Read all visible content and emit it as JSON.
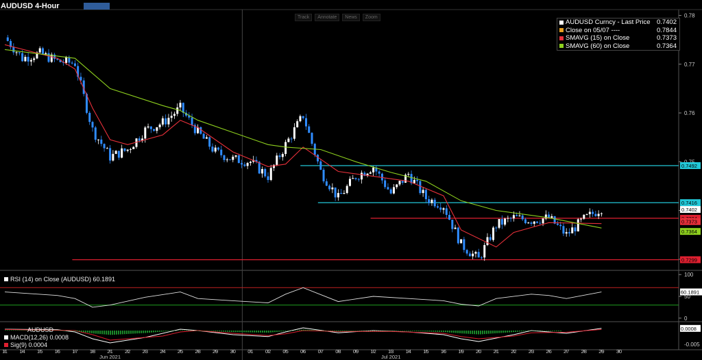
{
  "header": {
    "title": "AUDUSD 4-Hour",
    "toolbar": [
      "Track",
      "Annotate",
      "News",
      "Zoom"
    ]
  },
  "legend": [
    {
      "name": "AUDUSD Curncy - Last Price",
      "value": "0.7402",
      "color": "#ffffff"
    },
    {
      "name": "Close on 05/07 ----",
      "value": "0.7844",
      "color": "#e8a020"
    },
    {
      "name": "SMAVG (15)  on Close",
      "value": "0.7373",
      "color": "#e8303a"
    },
    {
      "name": "SMAVG (60)  on Close",
      "value": "0.7364",
      "color": "#8ed01e"
    }
  ],
  "rsi_panel": {
    "label": "RSI (14)  on Close (AUDUSD) 60.1891"
  },
  "macd_panel": {
    "ticker": "AUDUSD",
    "macd_label": "MACD(12,26) 0.0008",
    "sig_label": "Sig(9) 0.0004"
  },
  "chart_data": [
    {
      "type": "candlestick",
      "title": "AUDUSD 4-Hour",
      "y_ticks": [
        0.73,
        0.74,
        0.75,
        0.76,
        0.77,
        0.78
      ],
      "ylim": [
        0.728,
        0.7812
      ],
      "x_tick_labels": [
        "11",
        "14",
        "15",
        "16",
        "17",
        "18",
        "21",
        "22",
        "23",
        "24",
        "25",
        "28",
        "29",
        "30",
        "01",
        "02",
        "05",
        "06",
        "07",
        "08",
        "09",
        "12",
        "13",
        "14",
        "15",
        "16",
        "19",
        "20",
        "21",
        "22",
        "23",
        "26",
        "27",
        "28",
        "29",
        "30"
      ],
      "month_labels": [
        {
          "label": "Jun 2021",
          "at": "21"
        },
        {
          "label": "Jul 2021",
          "at": "13"
        }
      ],
      "horizontal_lines": [
        {
          "value": 0.7492,
          "label": "0.7492",
          "color": "#22c8d8",
          "start_date": "06",
          "extends_to_right": true
        },
        {
          "value": 0.7416,
          "label": "0.7416",
          "color": "#22c8d8",
          "start_date": "07",
          "extends_to_right": true
        },
        {
          "value": 0.7384,
          "label": "0.7384",
          "color": "#e02030",
          "start_date": "12",
          "extends_to_right": true
        },
        {
          "value": 0.7299,
          "label": "0.7299",
          "color": "#e02030",
          "start_date": "17",
          "extends_to_right": true
        }
      ],
      "value_tags": [
        {
          "value": 0.7402,
          "label": "0.7402",
          "color": "#ffffff"
        },
        {
          "value": 0.7373,
          "label": "0.7373",
          "color": "#e8303a"
        },
        {
          "value": 0.7364,
          "label": "0.7364",
          "color": "#8ed01e"
        }
      ],
      "price_path": [
        {
          "x": "11",
          "y": 0.7755
        },
        {
          "x": "14",
          "y": 0.7712
        },
        {
          "x": "15",
          "y": 0.7722
        },
        {
          "x": "16",
          "y": 0.7706
        },
        {
          "x": "17",
          "y": 0.7702
        },
        {
          "x": "18",
          "y": 0.7565
        },
        {
          "x": "21",
          "y": 0.751
        },
        {
          "x": "22",
          "y": 0.7525
        },
        {
          "x": "23",
          "y": 0.7565
        },
        {
          "x": "24",
          "y": 0.758
        },
        {
          "x": "25",
          "y": 0.761
        },
        {
          "x": "28",
          "y": 0.756
        },
        {
          "x": "29",
          "y": 0.752
        },
        {
          "x": "30",
          "y": 0.7505
        },
        {
          "x": "01",
          "y": 0.75
        },
        {
          "x": "02",
          "y": 0.747
        },
        {
          "x": "05",
          "y": 0.7535
        },
        {
          "x": "06",
          "y": 0.7595
        },
        {
          "x": "07",
          "y": 0.748
        },
        {
          "x": "08",
          "y": 0.7425
        },
        {
          "x": "09",
          "y": 0.747
        },
        {
          "x": "12",
          "y": 0.749
        },
        {
          "x": "13",
          "y": 0.7435
        },
        {
          "x": "14",
          "y": 0.7475
        },
        {
          "x": "15",
          "y": 0.7425
        },
        {
          "x": "16",
          "y": 0.741
        },
        {
          "x": "19",
          "y": 0.733
        },
        {
          "x": "20",
          "y": 0.73
        },
        {
          "x": "21",
          "y": 0.737
        },
        {
          "x": "22",
          "y": 0.7385
        },
        {
          "x": "23",
          "y": 0.738
        },
        {
          "x": "26",
          "y": 0.7385
        },
        {
          "x": "27",
          "y": 0.735
        },
        {
          "x": "28",
          "y": 0.7382
        },
        {
          "x": "29",
          "y": 0.7405
        }
      ],
      "series": [
        {
          "name": "SMAVG (15)  on Close",
          "color": "#e8303a",
          "values": [
            {
              "x": "11",
              "y": 0.774
            },
            {
              "x": "16",
              "y": 0.7712
            },
            {
              "x": "17",
              "y": 0.769
            },
            {
              "x": "18",
              "y": 0.761
            },
            {
              "x": "21",
              "y": 0.7545
            },
            {
              "x": "22",
              "y": 0.7535
            },
            {
              "x": "24",
              "y": 0.7555
            },
            {
              "x": "25",
              "y": 0.7585
            },
            {
              "x": "28",
              "y": 0.757
            },
            {
              "x": "30",
              "y": 0.752
            },
            {
              "x": "02",
              "y": 0.749
            },
            {
              "x": "05",
              "y": 0.7495
            },
            {
              "x": "06",
              "y": 0.753
            },
            {
              "x": "08",
              "y": 0.748
            },
            {
              "x": "12",
              "y": 0.747
            },
            {
              "x": "14",
              "y": 0.746
            },
            {
              "x": "16",
              "y": 0.743
            },
            {
              "x": "19",
              "y": 0.736
            },
            {
              "x": "21",
              "y": 0.7325
            },
            {
              "x": "22",
              "y": 0.7355
            },
            {
              "x": "26",
              "y": 0.7375
            },
            {
              "x": "29",
              "y": 0.7373
            }
          ]
        },
        {
          "name": "SMAVG (60)  on Close",
          "color": "#8ed01e",
          "values": [
            {
              "x": "11",
              "y": 0.773
            },
            {
              "x": "17",
              "y": 0.7712
            },
            {
              "x": "21",
              "y": 0.765
            },
            {
              "x": "24",
              "y": 0.7615
            },
            {
              "x": "25",
              "y": 0.7605
            },
            {
              "x": "28",
              "y": 0.7585
            },
            {
              "x": "30",
              "y": 0.756
            },
            {
              "x": "02",
              "y": 0.7535
            },
            {
              "x": "05",
              "y": 0.753
            },
            {
              "x": "07",
              "y": 0.7525
            },
            {
              "x": "09",
              "y": 0.75
            },
            {
              "x": "13",
              "y": 0.7478
            },
            {
              "x": "15",
              "y": 0.746
            },
            {
              "x": "19",
              "y": 0.742
            },
            {
              "x": "21",
              "y": 0.74
            },
            {
              "x": "26",
              "y": 0.7385
            },
            {
              "x": "29",
              "y": 0.7364
            }
          ]
        }
      ]
    },
    {
      "type": "line",
      "title": "RSI (14)  on Close (AUDUSD) 60.1891",
      "y_ticks": [
        0,
        50,
        100
      ],
      "ylim": [
        -5,
        105
      ],
      "current_value_label": "60.1891",
      "reference_lines": [
        {
          "value": 70,
          "color": "#c02020"
        },
        {
          "value": 30,
          "color": "#20a020"
        }
      ],
      "values": [
        {
          "x": "11",
          "y": 60
        },
        {
          "x": "16",
          "y": 52
        },
        {
          "x": "17",
          "y": 45
        },
        {
          "x": "18",
          "y": 25
        },
        {
          "x": "21",
          "y": 30
        },
        {
          "x": "23",
          "y": 48
        },
        {
          "x": "25",
          "y": 60
        },
        {
          "x": "28",
          "y": 45
        },
        {
          "x": "30",
          "y": 40
        },
        {
          "x": "02",
          "y": 35
        },
        {
          "x": "05",
          "y": 55
        },
        {
          "x": "06",
          "y": 70
        },
        {
          "x": "08",
          "y": 38
        },
        {
          "x": "12",
          "y": 50
        },
        {
          "x": "14",
          "y": 45
        },
        {
          "x": "16",
          "y": 40
        },
        {
          "x": "19",
          "y": 32
        },
        {
          "x": "20",
          "y": 28
        },
        {
          "x": "21",
          "y": 45
        },
        {
          "x": "23",
          "y": 55
        },
        {
          "x": "26",
          "y": 52
        },
        {
          "x": "27",
          "y": 45
        },
        {
          "x": "29",
          "y": 60
        }
      ]
    },
    {
      "type": "line",
      "title": "MACD(12,26) 0.0008",
      "y_ticks": [
        -0.005
      ],
      "ylim": [
        -0.0065,
        0.0025
      ],
      "current_value_label": "0.0008",
      "series": [
        {
          "name": "MACD(12,26)",
          "color": "#ffffff",
          "values": [
            {
              "x": "11",
              "y": 0.0005
            },
            {
              "x": "16",
              "y": 0.0003
            },
            {
              "x": "17",
              "y": -0.0005
            },
            {
              "x": "18",
              "y": -0.003
            },
            {
              "x": "21",
              "y": -0.0045
            },
            {
              "x": "23",
              "y": -0.0025
            },
            {
              "x": "25",
              "y": 0.0005
            },
            {
              "x": "28",
              "y": 0.0
            },
            {
              "x": "30",
              "y": -0.0015
            },
            {
              "x": "02",
              "y": -0.0022
            },
            {
              "x": "05",
              "y": -0.0005
            },
            {
              "x": "06",
              "y": 0.001
            },
            {
              "x": "08",
              "y": -0.0008
            },
            {
              "x": "12",
              "y": 0.0
            },
            {
              "x": "14",
              "y": -0.0005
            },
            {
              "x": "16",
              "y": -0.0015
            },
            {
              "x": "19",
              "y": -0.003
            },
            {
              "x": "20",
              "y": -0.004
            },
            {
              "x": "22",
              "y": -0.0015
            },
            {
              "x": "23",
              "y": 0.0
            },
            {
              "x": "26",
              "y": -0.0005
            },
            {
              "x": "27",
              "y": -0.001
            },
            {
              "x": "29",
              "y": 0.0008
            }
          ]
        },
        {
          "name": "Sig(9)",
          "color": "#e02030",
          "values": [
            {
              "x": "11",
              "y": 0.0004
            },
            {
              "x": "17",
              "y": 0.0
            },
            {
              "x": "18",
              "y": -0.0015
            },
            {
              "x": "21",
              "y": -0.0035
            },
            {
              "x": "24",
              "y": -0.002
            },
            {
              "x": "25",
              "y": -0.0005
            },
            {
              "x": "28",
              "y": 0.0
            },
            {
              "x": "30",
              "y": -0.001
            },
            {
              "x": "02",
              "y": -0.0018
            },
            {
              "x": "05",
              "y": -0.0012
            },
            {
              "x": "06",
              "y": 0.0
            },
            {
              "x": "08",
              "y": -0.0003
            },
            {
              "x": "13",
              "y": -0.0003
            },
            {
              "x": "16",
              "y": -0.001
            },
            {
              "x": "19",
              "y": -0.0022
            },
            {
              "x": "20",
              "y": -0.003
            },
            {
              "x": "22",
              "y": -0.002
            },
            {
              "x": "23",
              "y": -0.0008
            },
            {
              "x": "27",
              "y": -0.0006
            },
            {
              "x": "29",
              "y": 0.0004
            }
          ]
        }
      ]
    }
  ]
}
